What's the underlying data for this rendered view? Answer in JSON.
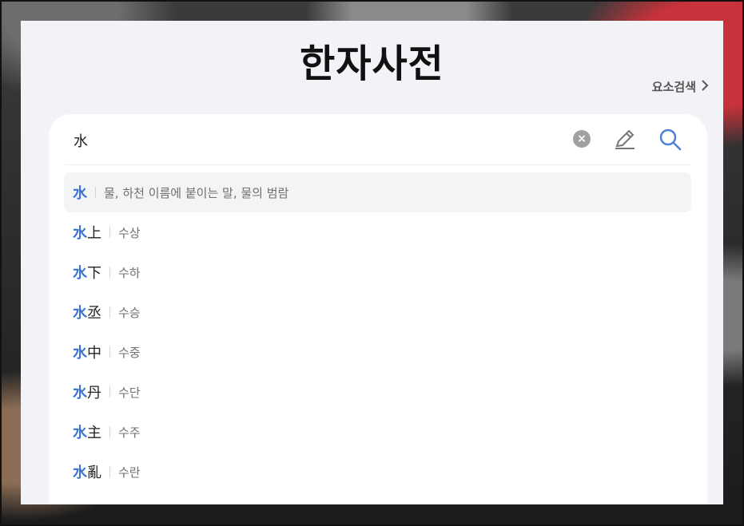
{
  "title": "한자사전",
  "element_search": {
    "label": "요소검색",
    "chevron": ">"
  },
  "search": {
    "value": "水",
    "clear_icon": "x-circle-icon",
    "pen_icon": "pen-icon",
    "search_icon": "search-icon"
  },
  "results": [
    {
      "highlight": "水",
      "rest": "",
      "meaning": "물, 하천 이름에 붙이는 말, 물의 범람"
    },
    {
      "highlight": "水",
      "rest": "上",
      "meaning": "수상"
    },
    {
      "highlight": "水",
      "rest": "下",
      "meaning": "수하"
    },
    {
      "highlight": "水",
      "rest": "丞",
      "meaning": "수승"
    },
    {
      "highlight": "水",
      "rest": "中",
      "meaning": "수중"
    },
    {
      "highlight": "水",
      "rest": "丹",
      "meaning": "수단"
    },
    {
      "highlight": "水",
      "rest": "主",
      "meaning": "수주"
    },
    {
      "highlight": "水",
      "rest": "亂",
      "meaning": "수란"
    }
  ],
  "colors": {
    "highlight": "#3b74d6",
    "search_icon": "#4a80d9"
  }
}
